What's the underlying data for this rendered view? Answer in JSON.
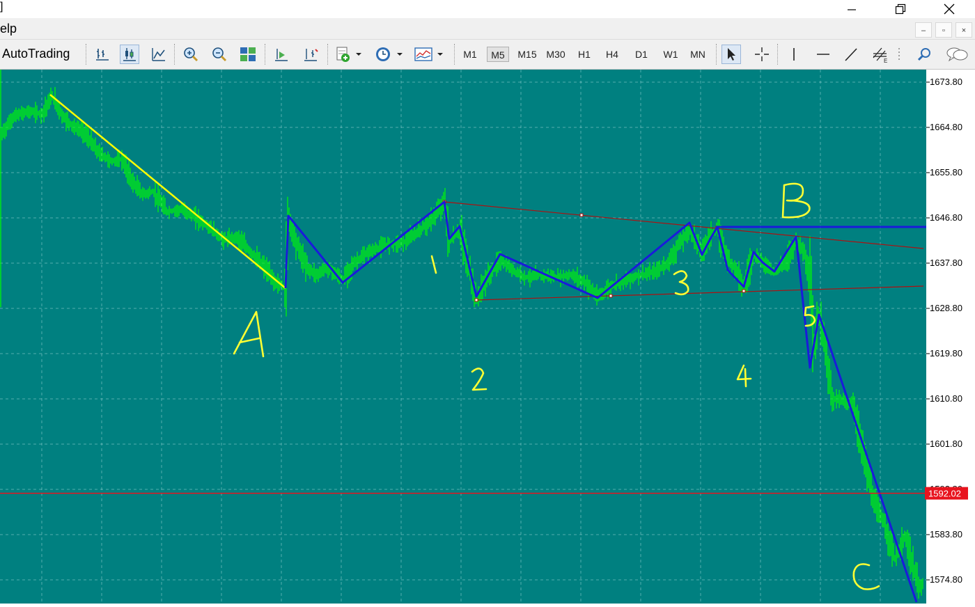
{
  "window": {
    "title_fragment": "]"
  },
  "menu": {
    "help_fragment": "elp",
    "mdi_minimize": "–",
    "mdi_restore": "▫",
    "mdi_close": "×"
  },
  "toolbar": {
    "autotrading_label": "AutoTrading",
    "timeframes": [
      "M1",
      "M5",
      "M15",
      "M30",
      "H1",
      "H4",
      "D1",
      "W1",
      "MN"
    ],
    "active_timeframe": "M5"
  },
  "colors": {
    "chart_bg": "#008080",
    "grid": "#9bd4d4",
    "candles": "#00ff00",
    "axis_bg": "#ffffff",
    "axis_text": "#000000",
    "bid_line": "#e8141e",
    "wave_blue": "#1a1adb",
    "trend_yellow": "#ffff00",
    "channel_red": "#b01010",
    "handwriting": "#ffff33"
  },
  "chart_data": {
    "type": "line",
    "symbol_instrument": "price chart",
    "yaxis_ticks": [
      "1673.80",
      "1664.80",
      "1655.80",
      "1646.80",
      "1637.80",
      "1628.80",
      "1619.80",
      "1610.80",
      "1601.80",
      "1592.80",
      "1583.80",
      "1574.80"
    ],
    "ylim": [
      1568.0,
      1675.0
    ],
    "current_price_label": "1592.02",
    "current_price": 1592.02,
    "price_path": [
      [
        0,
        1663.0
      ],
      [
        20,
        1667.0
      ],
      [
        40,
        1668.0
      ],
      [
        60,
        1667.5
      ],
      [
        75,
        1671.0
      ],
      [
        90,
        1667.0
      ],
      [
        105,
        1665.0
      ],
      [
        120,
        1664.0
      ],
      [
        140,
        1660.0
      ],
      [
        160,
        1658.0
      ],
      [
        175,
        1658.5
      ],
      [
        190,
        1654.0
      ],
      [
        205,
        1651.5
      ],
      [
        220,
        1652.0
      ],
      [
        240,
        1648.0
      ],
      [
        260,
        1648.5
      ],
      [
        280,
        1647.0
      ],
      [
        300,
        1645.0
      ],
      [
        320,
        1642.5
      ],
      [
        340,
        1643.0
      ],
      [
        360,
        1640.0
      ],
      [
        380,
        1637.0
      ],
      [
        395,
        1634.0
      ],
      [
        410,
        1633.0
      ],
      [
        414,
        1647.0
      ],
      [
        425,
        1642.0
      ],
      [
        440,
        1637.0
      ],
      [
        455,
        1635.5
      ],
      [
        470,
        1637.0
      ],
      [
        492,
        1634.5
      ],
      [
        510,
        1638.0
      ],
      [
        530,
        1640.0
      ],
      [
        555,
        1641.5
      ],
      [
        580,
        1642.0
      ],
      [
        600,
        1644.0
      ],
      [
        620,
        1646.5
      ],
      [
        638,
        1650.0
      ],
      [
        645,
        1642.0
      ],
      [
        660,
        1644.5
      ],
      [
        668,
        1640.0
      ],
      [
        675,
        1636.0
      ],
      [
        684,
        1630.5
      ],
      [
        700,
        1635.0
      ],
      [
        718,
        1638.5
      ],
      [
        735,
        1636.5
      ],
      [
        755,
        1635.0
      ],
      [
        775,
        1635.5
      ],
      [
        800,
        1635.0
      ],
      [
        820,
        1635.5
      ],
      [
        840,
        1634.0
      ],
      [
        858,
        1631.0
      ],
      [
        880,
        1633.5
      ],
      [
        900,
        1634.5
      ],
      [
        920,
        1635.5
      ],
      [
        940,
        1636.0
      ],
      [
        960,
        1638.0
      ],
      [
        975,
        1641.5
      ],
      [
        990,
        1644.5
      ],
      [
        1008,
        1640.0
      ],
      [
        1020,
        1643.5
      ],
      [
        1030,
        1644.5
      ],
      [
        1045,
        1638.5
      ],
      [
        1058,
        1636.5
      ],
      [
        1068,
        1633.0
      ],
      [
        1082,
        1639.5
      ],
      [
        1095,
        1638.0
      ],
      [
        1112,
        1636.0
      ],
      [
        1130,
        1638.5
      ],
      [
        1143,
        1642.5
      ],
      [
        1155,
        1640.0
      ],
      [
        1164,
        1634.0
      ],
      [
        1168,
        1620.0
      ],
      [
        1176,
        1628.0
      ],
      [
        1185,
        1621.0
      ],
      [
        1195,
        1611.0
      ],
      [
        1210,
        1610.5
      ],
      [
        1225,
        1609.5
      ],
      [
        1240,
        1600.0
      ],
      [
        1255,
        1590.0
      ],
      [
        1270,
        1586.0
      ],
      [
        1285,
        1579.0
      ],
      [
        1300,
        1583.5
      ],
      [
        1310,
        1578.0
      ],
      [
        1320,
        1573.0
      ],
      [
        1328,
        1574.5
      ]
    ],
    "grid": true,
    "annotations": {
      "wave_labels": [
        "1",
        "2",
        "3",
        "4",
        "5"
      ],
      "corrective_labels": [
        "A",
        "B",
        "C"
      ]
    }
  }
}
